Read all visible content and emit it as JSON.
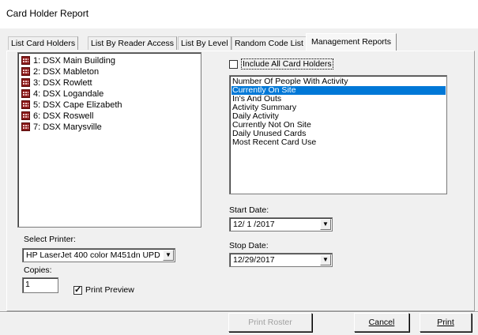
{
  "window": {
    "title": "Card Holder Report"
  },
  "tabs": [
    {
      "label": "List Card Holders"
    },
    {
      "label": "List By Reader Access"
    },
    {
      "label": "List By Level"
    },
    {
      "label": "Random Code List"
    },
    {
      "label": "Management Reports",
      "active": true
    }
  ],
  "buildings": [
    {
      "label": "1:  DSX Main Building"
    },
    {
      "label": "2:  DSX Mableton"
    },
    {
      "label": "3:  DSX Rowlett"
    },
    {
      "label": "4:  DSX Logandale"
    },
    {
      "label": "5:  DSX Cape Elizabeth"
    },
    {
      "label": "6:  DSX Roswell"
    },
    {
      "label": "7:  DSX Marysville"
    }
  ],
  "include_all": {
    "label": "Include All Card Holders",
    "checked": false
  },
  "reports": {
    "selected_index": 1,
    "items": [
      "Number Of People With Activity",
      "Currently On Site",
      "In's And Outs",
      "Activity Summary",
      "Daily Activity",
      "Currently Not On Site",
      "Daily Unused Cards",
      "Most Recent Card Use"
    ]
  },
  "start_date": {
    "label": "Start Date:",
    "value": "12/ 1 /2017"
  },
  "stop_date": {
    "label": "Stop Date:",
    "value": "12/29/2017"
  },
  "printer": {
    "label": "Select Printer:",
    "value": "HP LaserJet 400 color M451dn UPD I"
  },
  "copies": {
    "label": "Copies:",
    "value": "1"
  },
  "print_preview": {
    "label": "Print Preview",
    "checked": true
  },
  "buttons": {
    "print_roster": "Print Roster",
    "cancel": "Cancel",
    "print": "Print"
  },
  "colors": {
    "selection": "#0078d7",
    "icon": "#8b1a1a"
  },
  "icons": {
    "building": "building-icon",
    "dropdown": "chevron-down-icon"
  }
}
